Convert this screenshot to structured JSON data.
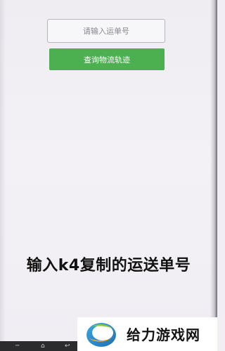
{
  "search": {
    "placeholder": "请输入运单号",
    "value": ""
  },
  "query_button": {
    "label": "查询物流轨迹"
  },
  "colors": {
    "button_green": "#4caf50",
    "background": "#f1eff3",
    "caption_text": "#111111"
  },
  "caption": {
    "text": "输入k4复制的运送单号"
  },
  "watermark": {
    "brand_text": "给力游戏网",
    "logo_icon": "crescent-swirl-logo"
  },
  "nav_bar": {
    "icons": [
      "menu-icon",
      "home-icon",
      "back-icon"
    ]
  }
}
